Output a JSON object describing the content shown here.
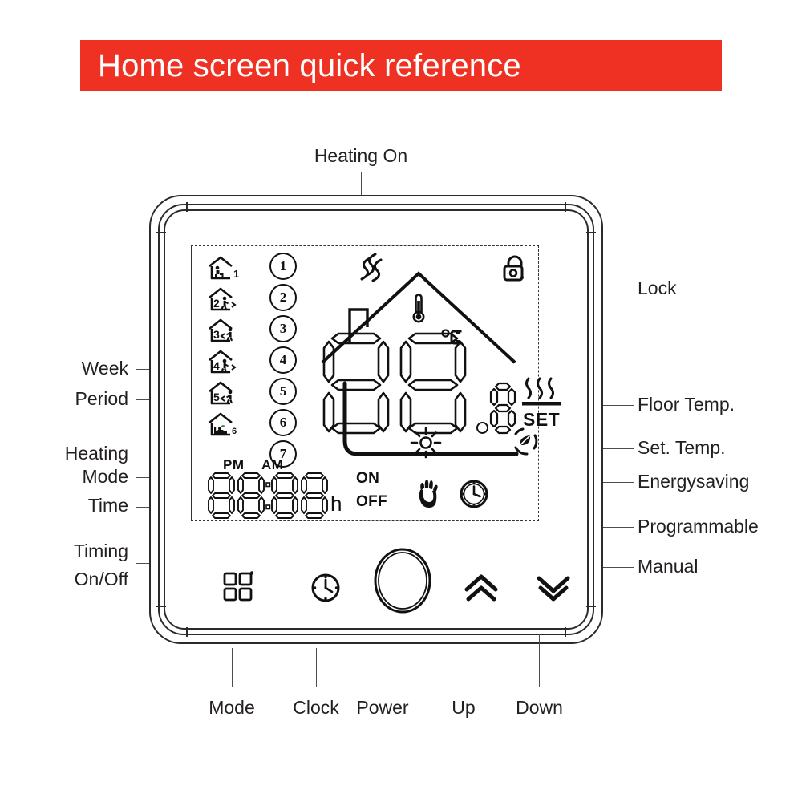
{
  "banner": {
    "title": "Home screen quick reference"
  },
  "device": {
    "name": "smart-thermostat",
    "type": "LCD touch thermostat front panel"
  },
  "callouts": {
    "top": [
      {
        "label": "Heating On",
        "target": "heat-wave-icon"
      }
    ],
    "left": [
      {
        "label": "Week",
        "target": "week-icon-column"
      },
      {
        "label": "Period",
        "target": "period-number-column"
      },
      {
        "label": "Heating\nMode",
        "line1": "Heating",
        "line2": "Mode",
        "target": "sun-icon"
      },
      {
        "label": "Time",
        "target": "clock-digits"
      },
      {
        "label": "Timing\nOn/Off",
        "line1": "Timing",
        "line2": "On/Off",
        "target": "on-off-indicator"
      }
    ],
    "right": [
      {
        "label": "Lock",
        "target": "lock-icon"
      },
      {
        "label": "Floor Temp.",
        "target": "floor-temp-icon"
      },
      {
        "label": "Set. Temp.",
        "target": "set-temp-indicator"
      },
      {
        "label": "Energysaving",
        "target": "energysaving-icon"
      },
      {
        "label": "Programmable",
        "target": "programmable-clock-icon"
      },
      {
        "label": "Manual",
        "target": "manual-hand-icon"
      }
    ],
    "bottom": [
      {
        "label": "Mode",
        "target": "mode-button"
      },
      {
        "label": "Clock",
        "target": "clock-button"
      },
      {
        "label": "Power",
        "target": "power-button"
      },
      {
        "label": "Up",
        "target": "up-button"
      },
      {
        "label": "Down",
        "target": "down-button"
      }
    ]
  },
  "lcd": {
    "week_icons": [
      {
        "digit": "1",
        "name": "week-icon-1"
      },
      {
        "digit": "2",
        "name": "week-icon-2"
      },
      {
        "digit": "3",
        "name": "week-icon-3"
      },
      {
        "digit": "4",
        "name": "week-icon-4"
      },
      {
        "digit": "5",
        "name": "week-icon-5"
      },
      {
        "digit": "6",
        "name": "week-icon-6"
      }
    ],
    "period_numbers": [
      "①",
      "②",
      "③",
      "④",
      "⑤",
      "⑥",
      "⑦"
    ],
    "period_digits": [
      "1",
      "2",
      "3",
      "4",
      "5",
      "6",
      "7"
    ],
    "temperature": {
      "value": "88",
      "decimal": "8",
      "unit": "°C",
      "decimal_separator": "."
    },
    "set_label": "SET",
    "clock": {
      "pm_label": "PM",
      "am_label": "AM",
      "digits": "88:88",
      "hour_unit": "h",
      "on_label": "ON",
      "off_label": "OFF"
    },
    "icons": [
      {
        "name": "heat-wave-icon",
        "meaning": "Heating On"
      },
      {
        "name": "lock-icon",
        "meaning": "Lock"
      },
      {
        "name": "thermometer-icon",
        "meaning": "Room temperature"
      },
      {
        "name": "house-outline-icon",
        "meaning": "Home"
      },
      {
        "name": "floor-temp-icon",
        "meaning": "Floor Temp."
      },
      {
        "name": "sun-icon",
        "meaning": "Heating Mode"
      },
      {
        "name": "energysaving-icon",
        "meaning": "Energysaving"
      },
      {
        "name": "manual-hand-icon",
        "meaning": "Manual"
      },
      {
        "name": "programmable-clock-icon",
        "meaning": "Programmable"
      }
    ]
  },
  "buttons": [
    {
      "name": "mode-button",
      "icon": "grid-icon",
      "label": "Mode"
    },
    {
      "name": "clock-button",
      "icon": "clock-icon",
      "label": "Clock"
    },
    {
      "name": "power-button",
      "icon": "circle-icon",
      "label": "Power"
    },
    {
      "name": "up-button",
      "icon": "double-chevron-up-icon",
      "label": "Up"
    },
    {
      "name": "down-button",
      "icon": "double-chevron-down-icon",
      "label": "Down"
    }
  ],
  "colors": {
    "banner_background": "#ef3124",
    "banner_text": "#ffffff",
    "ink": "#231f20",
    "leader_line": "#4d4d4d"
  }
}
